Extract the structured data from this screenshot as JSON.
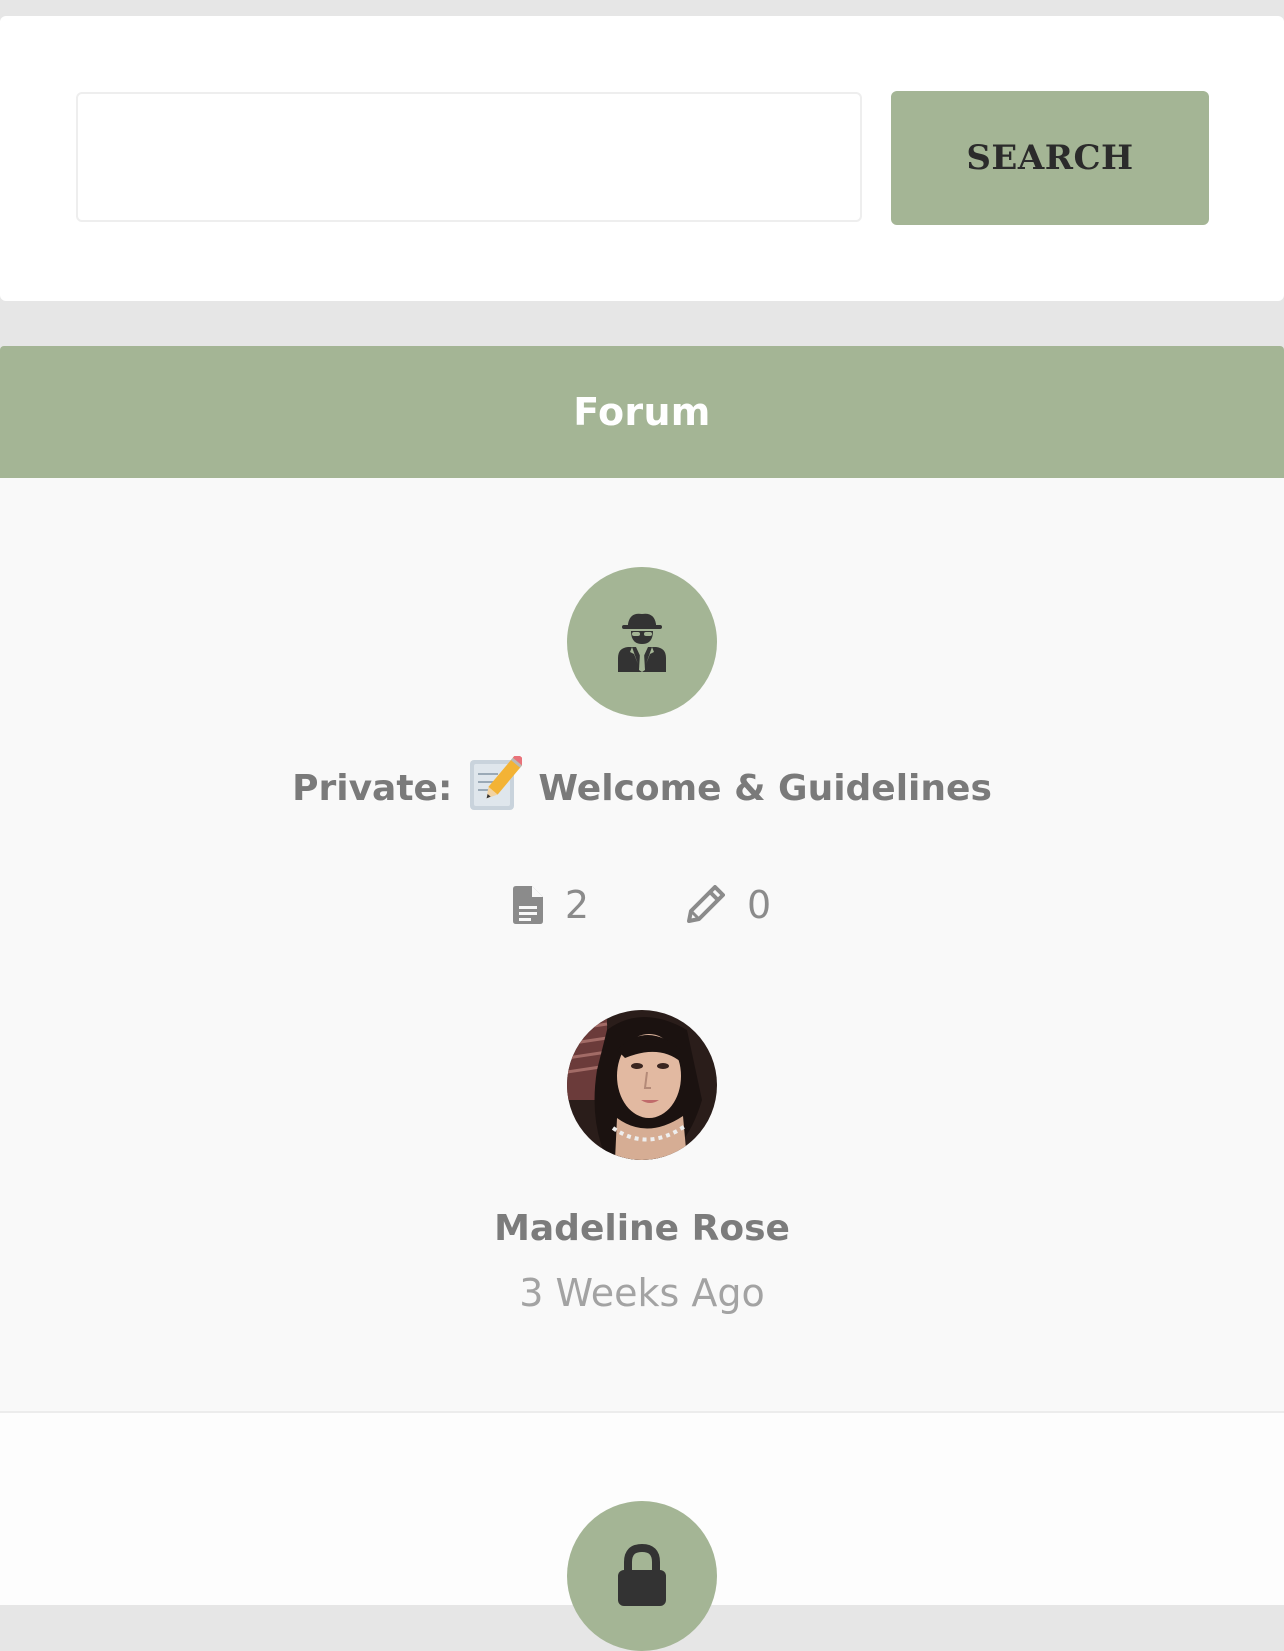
{
  "search": {
    "placeholder": "",
    "value": "",
    "button_label": "SEARCH"
  },
  "forum": {
    "header_title": "Forum",
    "items": [
      {
        "icon": "user-secret-icon",
        "prefix": "Private:",
        "emoji_icon": "memo-icon",
        "title": "Welcome & Guidelines",
        "topics_icon": "document-icon",
        "topics_count": "2",
        "posts_icon": "pencil-icon",
        "posts_count": "0",
        "last_author": "Madeline Rose",
        "last_time": "3 Weeks Ago"
      },
      {
        "icon": "lock-icon"
      }
    ]
  },
  "colors": {
    "accent": "#a4b595",
    "page_background": "#e6e6e6",
    "text_muted": "#7a7a7a"
  }
}
